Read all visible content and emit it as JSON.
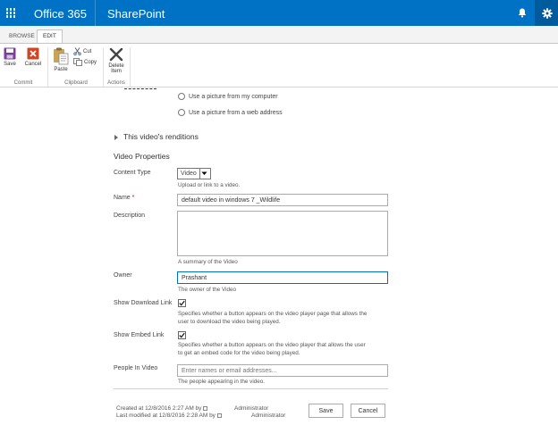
{
  "suite": {
    "brand": "Office 365",
    "product": "SharePoint"
  },
  "tabs": [
    "BROWSE",
    "EDIT"
  ],
  "ribbon": {
    "save": "Save",
    "cancel": "Cancel",
    "paste": "Paste",
    "cut": "Cut",
    "copy": "Copy",
    "delete_line1": "Delete",
    "delete_line2": "Item",
    "groups": {
      "commit": "Commit",
      "clipboard": "Clipboard",
      "actions": "Actions"
    }
  },
  "thumbnail_options": {
    "from_computer": "Use a picture from my computer",
    "from_web": "Use a picture from a web address"
  },
  "renditions_label": "This video's renditions",
  "properties_heading": "Video Properties",
  "form": {
    "content_type": {
      "label": "Content Type",
      "value": "Video",
      "hint": "Upload or link to a video."
    },
    "name": {
      "label": "Name",
      "required_mark": "*",
      "value": "default video in windows 7 _Wildlife"
    },
    "description": {
      "label": "Description",
      "hint": "A summary of the Video"
    },
    "owner": {
      "label": "Owner",
      "value": "Prashant",
      "hint": "The owner of the Video"
    },
    "show_download": {
      "label": "Show Download Link",
      "checked": true,
      "hint_line1": "Specifies whether a button appears on the video player page that allows the",
      "hint_line2": "user to download the video being played."
    },
    "show_embed": {
      "label": "Show Embed Link",
      "checked": true,
      "hint_line1": "Specifies whether a button appears on the video player that allows the user",
      "hint_line2": "to get an embed code for the video being played."
    },
    "people": {
      "label": "People In Video",
      "placeholder": "Enter names or email addresses...",
      "hint": "The people appearing in the video."
    }
  },
  "footer": {
    "created": "Created at 12/8/2016 2:27 AM  by",
    "created_by": "Administrator",
    "modified": "Last modified at 12/8/2016 2:28 AM  by",
    "modified_by": "Administrator",
    "save": "Save",
    "cancel": "Cancel"
  },
  "colors": {
    "suitebar": "#0072c6",
    "accent": "#0072c6",
    "required": "#c00000"
  }
}
